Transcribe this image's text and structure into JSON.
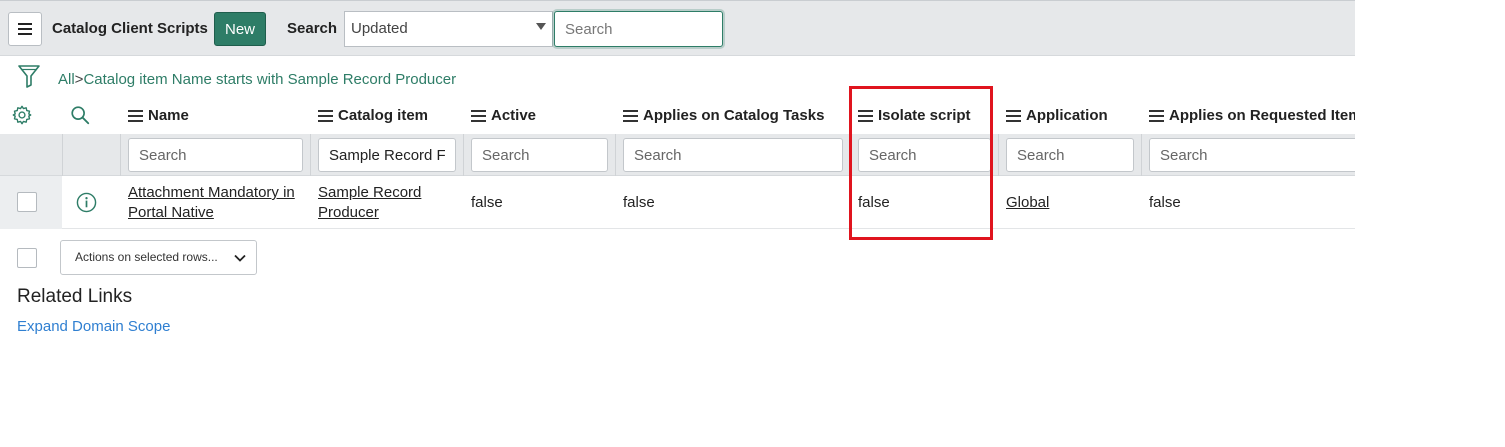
{
  "header": {
    "title": "Catalog Client Scripts",
    "new_label": "New",
    "search_label": "Search",
    "search_field_selected": "Updated",
    "search_placeholder": "Search"
  },
  "breadcrumb": {
    "all": "All",
    "separator": ">",
    "condition": "Catalog item Name starts with Sample Record Producer"
  },
  "columns": [
    {
      "label": "Name",
      "search_placeholder": "Search",
      "search_value": ""
    },
    {
      "label": "Catalog item",
      "search_placeholder": "Search",
      "search_value": "Sample Record F"
    },
    {
      "label": "Active",
      "search_placeholder": "Search",
      "search_value": ""
    },
    {
      "label": "Applies on Catalog Tasks",
      "search_placeholder": "Search",
      "search_value": ""
    },
    {
      "label": "Isolate script",
      "search_placeholder": "Search",
      "search_value": ""
    },
    {
      "label": "Application",
      "search_placeholder": "Search",
      "search_value": ""
    },
    {
      "label": "Applies on Requested Item",
      "search_placeholder": "Search",
      "search_value": ""
    }
  ],
  "rows": [
    {
      "name_line1": "Attachment Mandatory in",
      "name_line2": "Portal Native",
      "catalog_item_line1": "Sample Record",
      "catalog_item_line2": "Producer",
      "active": "false",
      "applies_on_catalog_tasks": "false",
      "isolate_script": "false",
      "application": "Global",
      "applies_on_requested_item": "false"
    }
  ],
  "footer": {
    "actions_label": "Actions on selected rows...",
    "related_links_title": "Related Links",
    "expand_domain_scope": "Expand Domain Scope"
  },
  "colors": {
    "accent": "#2e7d67",
    "link": "#2f7fd1",
    "highlight": "#e0141e",
    "header_bg": "#e6e8ea"
  },
  "icons": [
    "menu-icon",
    "filter-icon",
    "gear-icon",
    "search-icon",
    "info-icon",
    "chevron-down-icon",
    "caret-down-icon"
  ]
}
